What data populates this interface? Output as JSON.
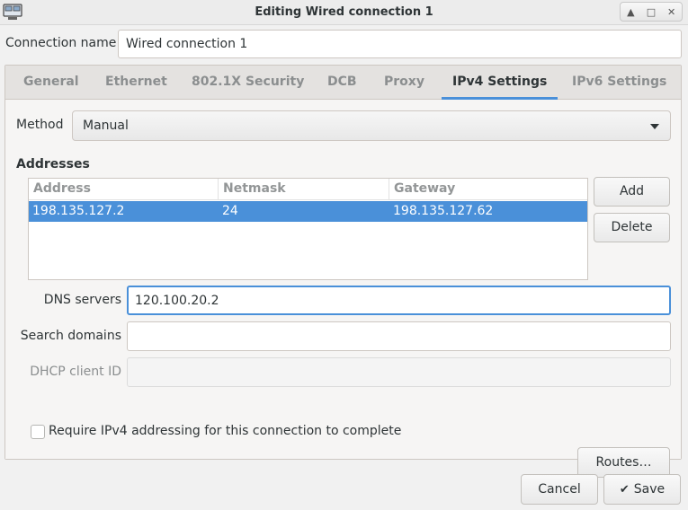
{
  "window": {
    "title": "Editing Wired connection 1",
    "wm_buttons": [
      "▲",
      "□",
      "✕"
    ]
  },
  "connection_name": {
    "label": "Connection name",
    "value": "Wired connection 1"
  },
  "tabs": [
    {
      "label": "General"
    },
    {
      "label": "Ethernet"
    },
    {
      "label": "802.1X Security"
    },
    {
      "label": "DCB"
    },
    {
      "label": "Proxy"
    },
    {
      "label": "IPv4 Settings",
      "active": true
    },
    {
      "label": "IPv6 Settings"
    }
  ],
  "ipv4": {
    "method_label": "Method",
    "method_value": "Manual",
    "addresses_title": "Addresses",
    "columns": [
      "Address",
      "Netmask",
      "Gateway"
    ],
    "rows": [
      {
        "address": "198.135.127.2",
        "netmask": "24",
        "gateway": "198.135.127.62",
        "selected": true
      }
    ],
    "add_label": "Add",
    "delete_label": "Delete",
    "dns_label": "DNS servers",
    "dns_value": "120.100.20.2",
    "search_label": "Search domains",
    "search_value": "",
    "dhcp_label": "DHCP client ID",
    "dhcp_value": "",
    "require_label": "Require IPv4 addressing for this connection to complete",
    "require_checked": false,
    "routes_label": "Routes…"
  },
  "footer": {
    "cancel_label": "Cancel",
    "save_label": "Save",
    "save_icon": "✔"
  },
  "colors": {
    "accent": "#4a90d9"
  }
}
